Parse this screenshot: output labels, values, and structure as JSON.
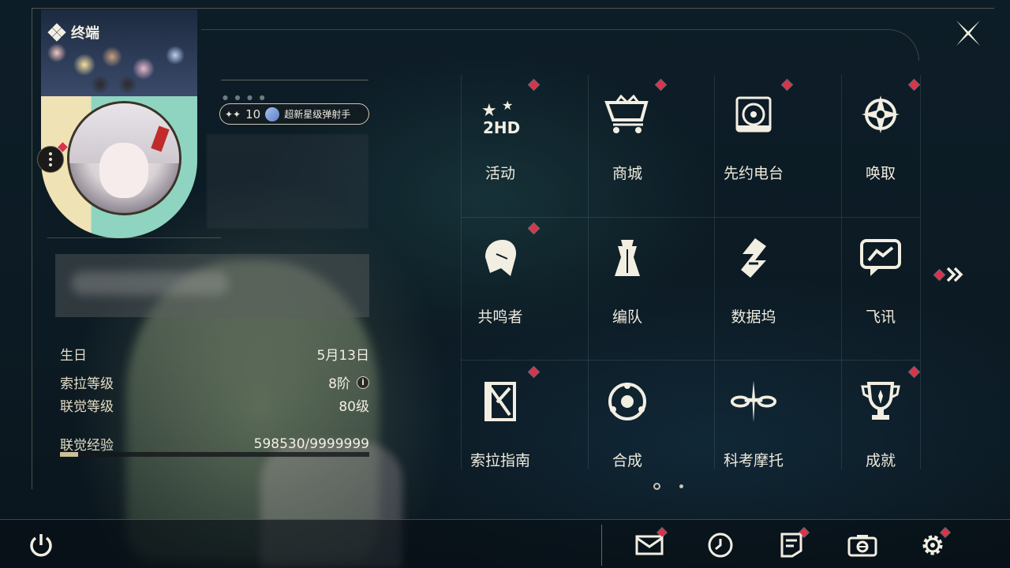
{
  "header": {
    "title": "终端",
    "close_icon": "close-x-icon"
  },
  "profile": {
    "badge_count": "10",
    "badge_prefix": "✦✦",
    "title_text": "超新星级弹射手",
    "stats": [
      {
        "label": "生日",
        "value": "5月13日"
      },
      {
        "label": "索拉等级",
        "value": "8阶"
      },
      {
        "label": "联觉等级",
        "value": "80级"
      }
    ],
    "exp_label": "联觉经验",
    "exp_value": "598530/9999999",
    "exp_progress": 0.0599
  },
  "menu": {
    "items": [
      {
        "label": "活动",
        "icon": "event-2hd-icon",
        "notify": true
      },
      {
        "label": "商城",
        "icon": "shop-cart-icon",
        "notify": true
      },
      {
        "label": "先约电台",
        "icon": "radio-icon",
        "notify": true
      },
      {
        "label": "唤取",
        "icon": "convene-icon",
        "notify": true
      },
      {
        "label": "共鸣者",
        "icon": "resonator-icon",
        "notify": true
      },
      {
        "label": "编队",
        "icon": "team-chess-icon",
        "notify": false
      },
      {
        "label": "数据坞",
        "icon": "data-bank-icon",
        "notify": false
      },
      {
        "label": "飞讯",
        "icon": "message-bubble-icon",
        "notify": false
      },
      {
        "label": "索拉指南",
        "icon": "guide-book-icon",
        "notify": true
      },
      {
        "label": "合成",
        "icon": "synthesis-icon",
        "notify": false
      },
      {
        "label": "科考摩托",
        "icon": "motorbike-icon",
        "notify": false
      },
      {
        "label": "成就",
        "icon": "trophy-icon",
        "notify": true
      }
    ],
    "next_page_icon": "double-chevron-right-icon",
    "page_count": 2,
    "current_page": 1
  },
  "bottom_bar": {
    "power_icon": "power-icon",
    "buttons": [
      {
        "icon": "mail-icon",
        "notify": true
      },
      {
        "icon": "clock-icon",
        "notify": false
      },
      {
        "icon": "notice-icon",
        "notify": true
      },
      {
        "icon": "camera-icon",
        "notify": false
      },
      {
        "icon": "settings-gear-icon",
        "notify": true
      }
    ]
  },
  "colors": {
    "accent": "#cdbf98",
    "notify": "#d9344c",
    "text": "#efeadc"
  }
}
